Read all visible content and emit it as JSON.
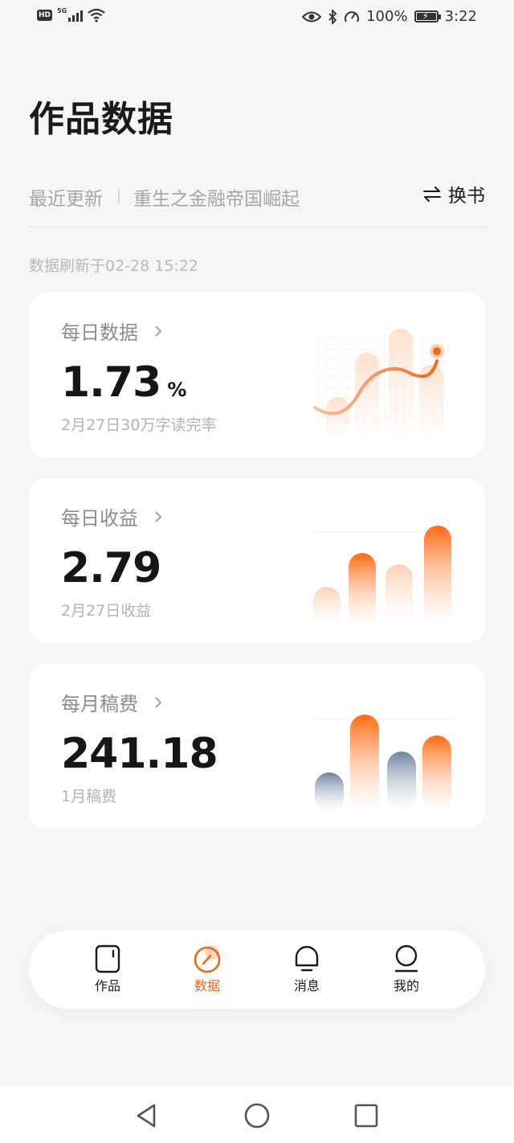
{
  "status_bar": {
    "hd": "HD",
    "network": "5G",
    "battery_percent": "100%",
    "time": "3:22"
  },
  "page": {
    "title": "作品数据"
  },
  "book_row": {
    "recent_label": "最近更新",
    "book_name": "重生之金融帝国崛起",
    "switch_label": "换书"
  },
  "refresh_time": "数据刷新于02-28 15:22",
  "cards": [
    {
      "title": "每日数据",
      "value": "1.73",
      "unit": "%",
      "caption": "2月27日30万字读完率",
      "chart_icon": "line-trend-illustration"
    },
    {
      "title": "每日收益",
      "value": "2.79",
      "unit": "",
      "caption": "2月27日收益",
      "chart_icon": "orange-bars-illustration"
    },
    {
      "title": "每月稿费",
      "value": "241.18",
      "unit": "",
      "caption": "1月稿费",
      "chart_icon": "mixed-bars-illustration"
    }
  ],
  "bottom_nav": {
    "items": [
      {
        "label": "作品",
        "icon": "book-icon",
        "active": false
      },
      {
        "label": "数据",
        "icon": "data-dial-icon",
        "active": true
      },
      {
        "label": "消息",
        "icon": "bell-icon",
        "active": false
      },
      {
        "label": "我的",
        "icon": "user-icon",
        "active": false
      }
    ]
  },
  "colors": {
    "accent": "#e66a1e",
    "accent_light": "#ff8a3d",
    "slate": "#6b84a0",
    "background": "#f6f6f6",
    "card": "#ffffff"
  }
}
